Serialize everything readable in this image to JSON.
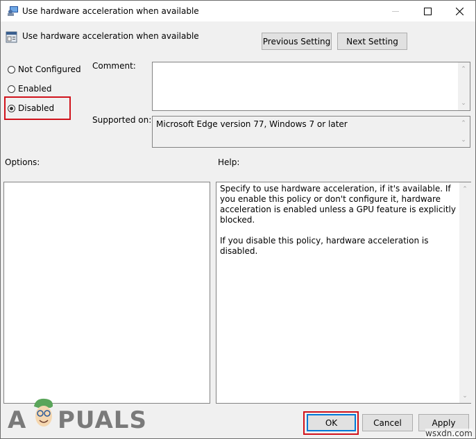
{
  "window": {
    "title": "Use hardware acceleration when available",
    "minimize_icon": "minimize-icon",
    "maximize_icon": "maximize-icon",
    "close_icon": "close-icon"
  },
  "header": {
    "policy_name": "Use hardware acceleration when available",
    "previous_setting_label": "Previous Setting",
    "next_setting_label": "Next Setting"
  },
  "state": {
    "options": [
      {
        "label": "Not Configured",
        "checked": false
      },
      {
        "label": "Enabled",
        "checked": false
      },
      {
        "label": "Disabled",
        "checked": true
      }
    ],
    "highlight_color": "#d0121b"
  },
  "comment": {
    "label": "Comment:",
    "value": ""
  },
  "supported": {
    "label": "Supported on:",
    "value": "Microsoft Edge version 77, Windows 7 or later"
  },
  "options_panel": {
    "label": "Options:"
  },
  "help_panel": {
    "label": "Help:",
    "paragraph1": "Specify to use hardware acceleration, if it's available. If you enable this policy or don't configure it, hardware acceleration is enabled unless a GPU feature is explicitly blocked.",
    "paragraph2": "If you disable this policy, hardware acceleration is disabled."
  },
  "footer": {
    "ok_label": "OK",
    "cancel_label": "Cancel",
    "apply_label": "Apply"
  },
  "watermarks": {
    "logo_text_a": "A",
    "logo_text_rest": "PUALS",
    "site": "wsxdn.com"
  }
}
